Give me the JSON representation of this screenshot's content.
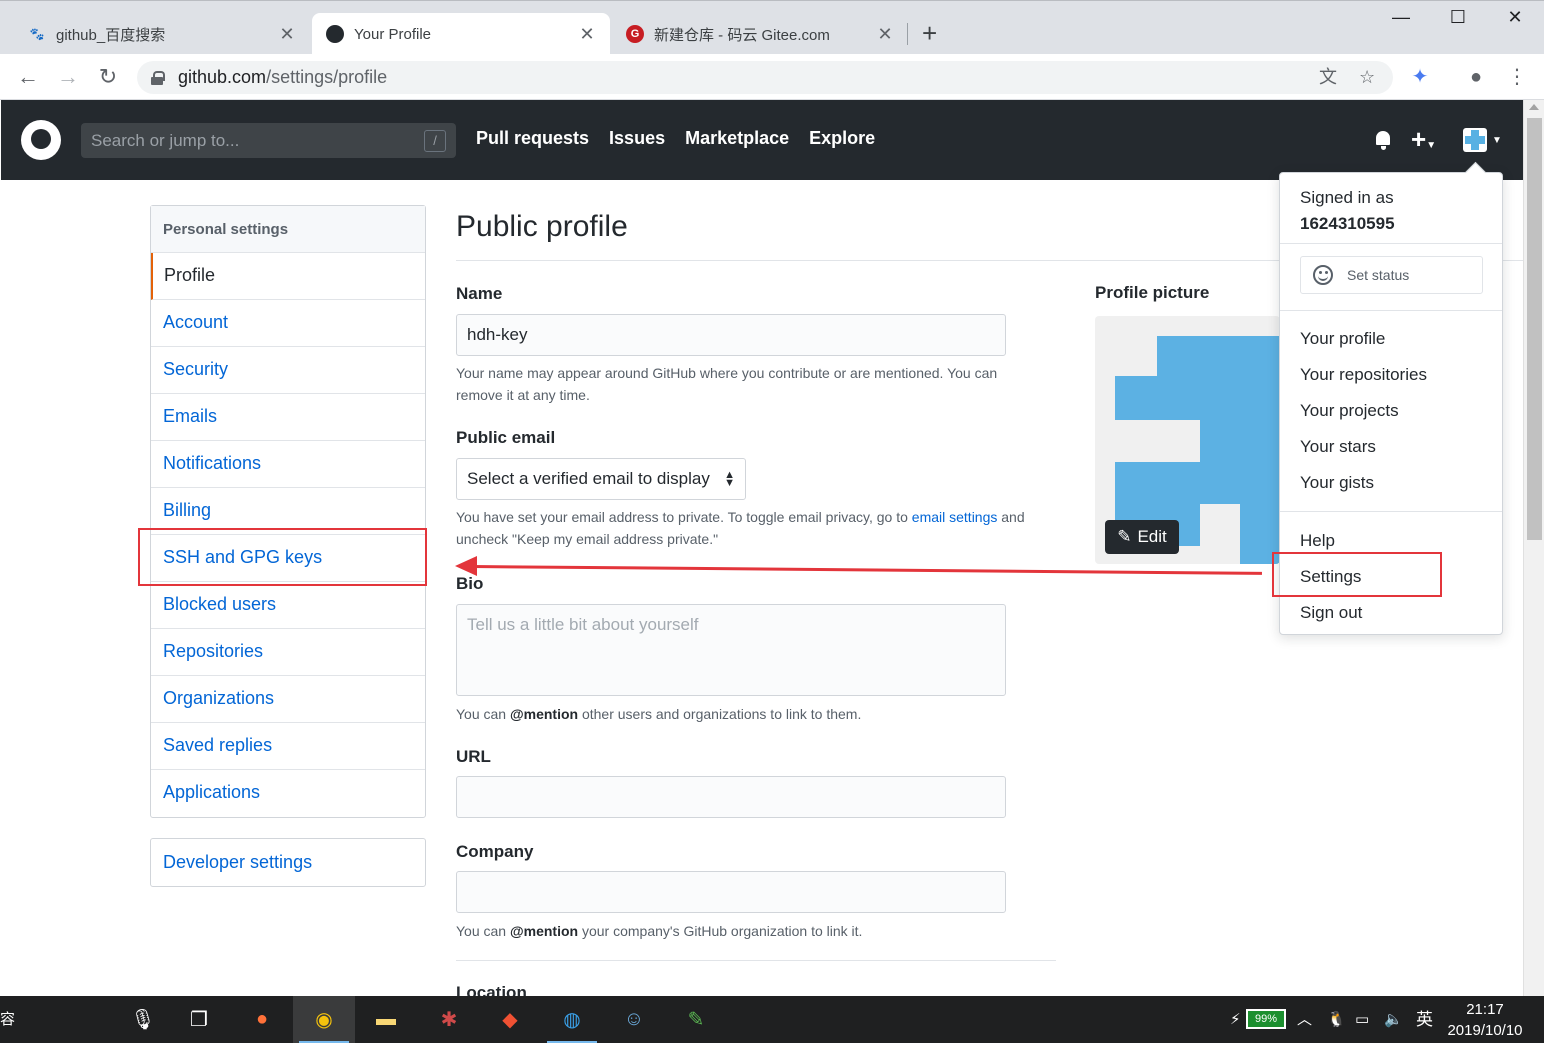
{
  "browser": {
    "tabs": [
      {
        "title": "github_百度搜索",
        "active": false,
        "icon": "baidu-icon"
      },
      {
        "title": "Your Profile",
        "active": true,
        "icon": "github-icon"
      },
      {
        "title": "新建仓库 - 码云 Gitee.com",
        "active": false,
        "icon": "gitee-icon"
      }
    ],
    "new_tab": "+",
    "url_host": "github.com",
    "url_path": "/settings/profile"
  },
  "header": {
    "search_placeholder": "Search or jump to...",
    "slash_hint": "/",
    "nav": [
      "Pull requests",
      "Issues",
      "Marketplace",
      "Explore"
    ]
  },
  "sidebar": {
    "heading": "Personal settings",
    "items": [
      "Profile",
      "Account",
      "Security",
      "Emails",
      "Notifications",
      "Billing",
      "SSH and GPG keys",
      "Blocked users",
      "Repositories",
      "Organizations",
      "Saved replies",
      "Applications"
    ],
    "selected": "Profile",
    "developer": "Developer settings"
  },
  "main": {
    "title": "Public profile",
    "name_label": "Name",
    "name_value": "hdh-key",
    "name_note": "Your name may appear around GitHub where you contribute or are mentioned. You can remove it at any time.",
    "email_label": "Public email",
    "email_select": "Select a verified email to display",
    "email_note_1": "You have set your email address to private. To toggle email privacy, go to ",
    "email_note_link": "email settings",
    "email_note_2": " and uncheck \"Keep my email address private.\"",
    "bio_label": "Bio",
    "bio_placeholder": "Tell us a little bit about yourself",
    "bio_note_1": "You can ",
    "bio_note_mention": "@mention",
    "bio_note_2": " other users and organizations to link to them.",
    "url_label": "URL",
    "company_label": "Company",
    "company_note_1": "You can ",
    "company_note_mention": "@mention",
    "company_note_2": " your company's GitHub organization to link it.",
    "location_label": "Location",
    "picture_label": "Profile picture",
    "edit_label": "Edit"
  },
  "dropdown": {
    "signed_in_as": "Signed in as",
    "username": "1624310595",
    "set_status": "Set status",
    "items_group1": [
      "Your profile",
      "Your repositories",
      "Your projects",
      "Your stars",
      "Your gists"
    ],
    "help": "Help",
    "settings": "Settings",
    "sign_out": "Sign out"
  },
  "taskbar": {
    "left_char": "容",
    "battery": "99%",
    "ime": "英",
    "time": "21:17",
    "date": "2019/10/10"
  },
  "colors": {
    "annotation_red": "#e3353b",
    "gh_header": "#24292e",
    "link_blue": "#0366d6",
    "avatar_blue": "#5cb1e3"
  }
}
